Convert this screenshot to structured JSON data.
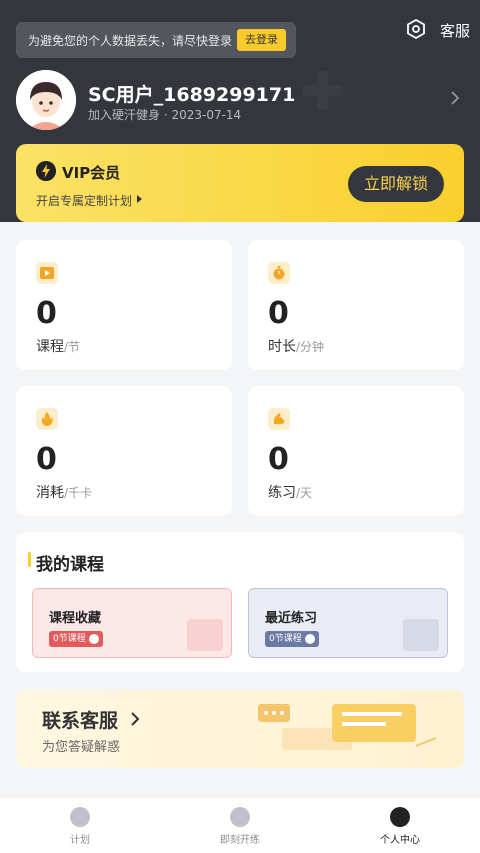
{
  "header": {
    "notice_text": "为避免您的个人数据丢失，请尽快登录",
    "login_btn": "去登录",
    "service_label": "客服"
  },
  "user": {
    "name": "SC用户_1689299171",
    "join_date": "加入硬汗健身 · 2023-07-14"
  },
  "vip": {
    "title": "VIP会员",
    "subtitle": "开启专属定制计划",
    "button": "立即解锁"
  },
  "stats": [
    {
      "value": "0",
      "label": "课程",
      "unit": "/节"
    },
    {
      "value": "0",
      "label": "时长",
      "unit": "/分钟"
    },
    {
      "value": "0",
      "label": "消耗",
      "unit": "/千卡"
    },
    {
      "value": "0",
      "label": "练习",
      "unit": "/天"
    }
  ],
  "courses": {
    "title": "我的课程",
    "cards": [
      {
        "title": "课程收藏",
        "badge": "0节课程"
      },
      {
        "title": "最近练习",
        "badge": "0节课程"
      }
    ]
  },
  "contact": {
    "title": "联系客服",
    "subtitle": "为您答疑解惑"
  },
  "tabs": [
    {
      "label": "计划",
      "icon": "pulse-icon"
    },
    {
      "label": "即刻开练",
      "icon": "stopwatch-icon"
    },
    {
      "label": "个人中心",
      "icon": "person-icon"
    }
  ],
  "colors": {
    "accent": "#f9cf2d",
    "header_bg": "#33363d",
    "favorite_card": "#fde8e8",
    "recent_card": "#e9ecf5"
  }
}
